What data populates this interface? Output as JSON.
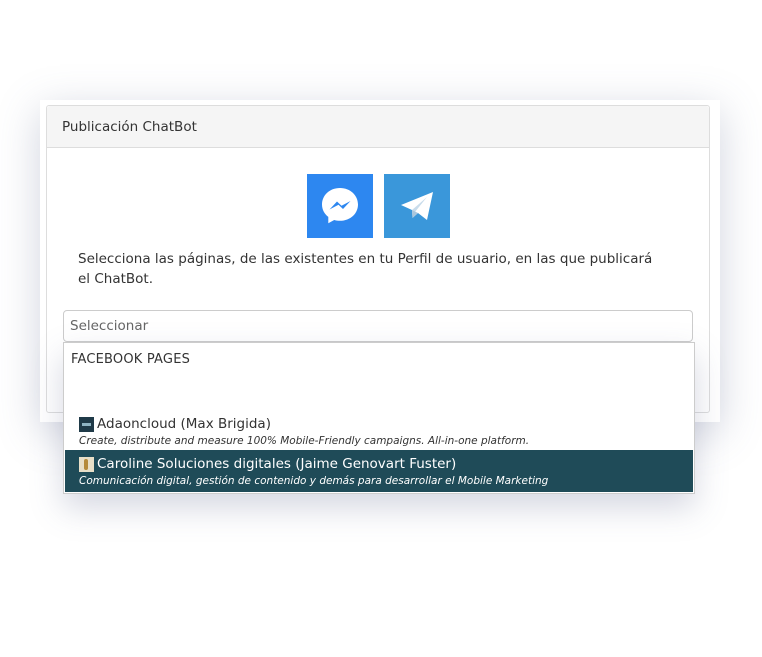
{
  "panel": {
    "title": "Publicación ChatBot",
    "intro": "Selecciona las páginas, de las existentes en tu Perfil de usuario, en las que publicará el ChatBot."
  },
  "channels": [
    {
      "icon": "messenger-icon",
      "color": "#2d87f0"
    },
    {
      "icon": "telegram-icon",
      "color": "#3a97da"
    }
  ],
  "select": {
    "placeholder": "Seleccionar",
    "group_label": "FACEBOOK PAGES",
    "options": [
      {
        "name": "Adaoncloud (Max Brigida)",
        "description": "Create, distribute and measure 100% Mobile-Friendly campaigns. All-in-one platform.",
        "selected": false
      },
      {
        "name": "Caroline Soluciones digitales (Jaime Genovart Fuster)",
        "description": "Comunicación digital, gestión de contenido y demás para desarrollar el Mobile Marketing",
        "selected": true
      }
    ],
    "highlight_color": "#1f4b58"
  }
}
